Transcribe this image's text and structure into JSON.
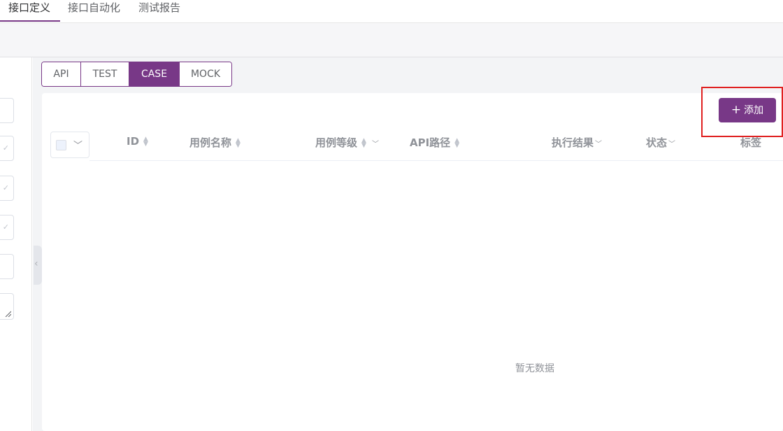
{
  "top_tabs": [
    {
      "label": "接口定义",
      "active": true
    },
    {
      "label": "接口自动化",
      "active": false
    },
    {
      "label": "测试报告",
      "active": false
    }
  ],
  "mode_tabs": [
    {
      "label": "API",
      "active": false
    },
    {
      "label": "TEST",
      "active": false
    },
    {
      "label": "CASE",
      "active": true
    },
    {
      "label": "MOCK",
      "active": false
    }
  ],
  "toolbar": {
    "add_label": "添加",
    "add_icon": "plus-icon"
  },
  "table": {
    "columns": [
      {
        "label": "ID",
        "sortable": true
      },
      {
        "label": "用例名称",
        "sortable": true
      },
      {
        "label": "用例等级",
        "sortable": true,
        "filterable": true
      },
      {
        "label": "API路径",
        "sortable": true
      },
      {
        "label": "执行结果",
        "filterable": true
      },
      {
        "label": "状态",
        "filterable": true
      },
      {
        "label": "标签"
      }
    ],
    "empty_text": "暂无数据"
  },
  "colors": {
    "accent": "#783887",
    "highlight": "#e02020"
  }
}
